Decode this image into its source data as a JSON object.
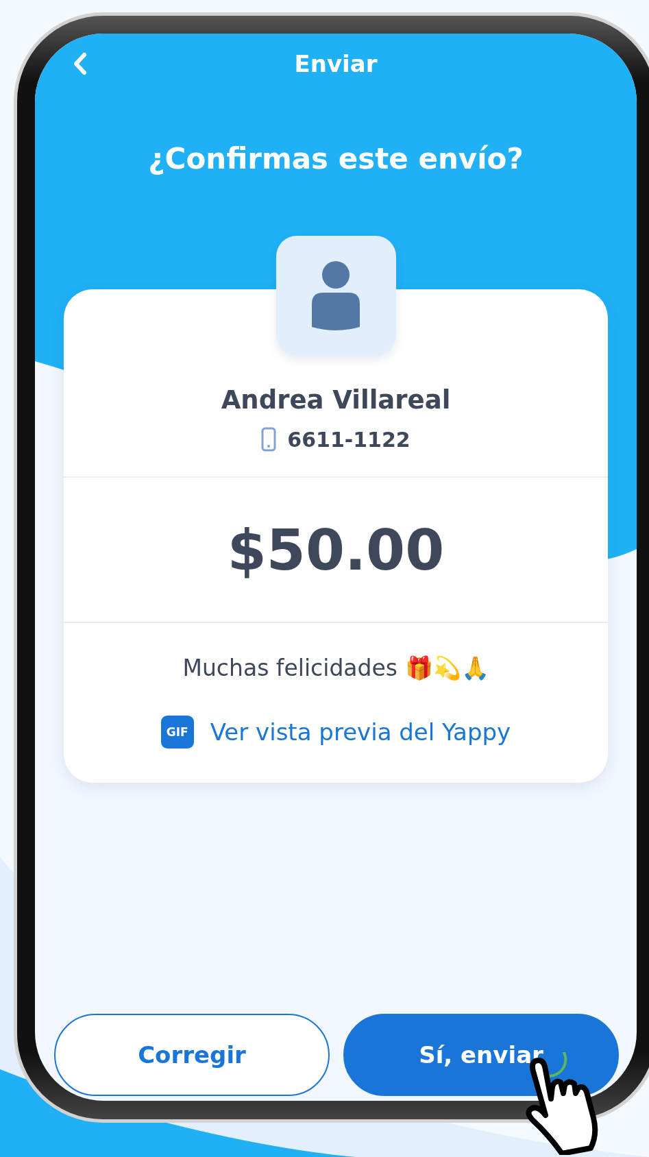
{
  "header": {
    "title": "Enviar"
  },
  "heading": "¿Confirmas este envío?",
  "recipient": {
    "name": "Andrea Villareal",
    "phone": "6611-1122"
  },
  "amount": "$50.00",
  "message": "Muchas felicidades 🎁💫🙏",
  "preview": {
    "badge": "GIF",
    "label": "Ver vista previa del Yappy"
  },
  "buttons": [
    {
      "label": "Corregir",
      "kind": "secondary"
    },
    {
      "label": "Sí, enviar",
      "kind": "primary"
    }
  ]
}
